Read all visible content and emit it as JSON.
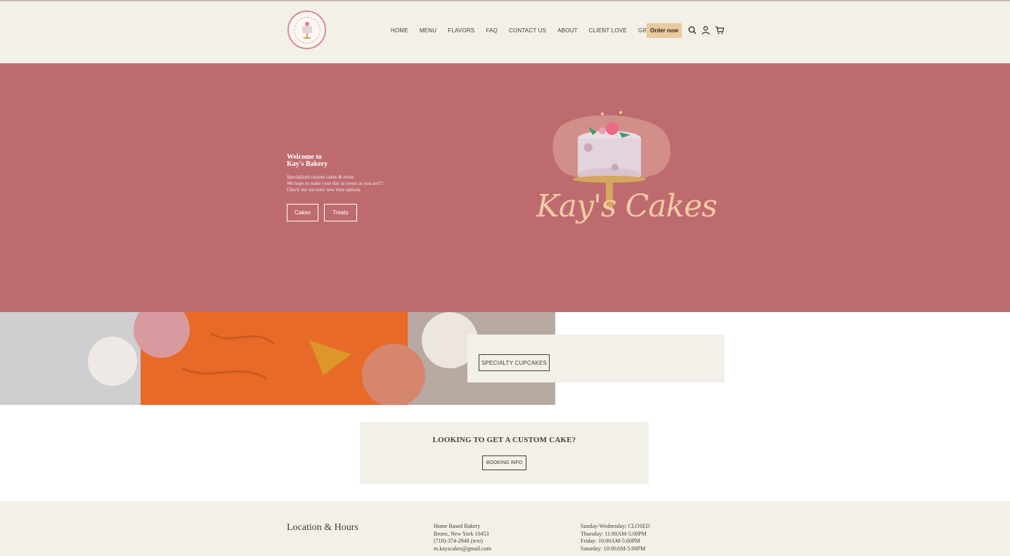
{
  "header": {
    "logo_alt": "Kay's Cakes logo",
    "nav": [
      "HOME",
      "MENU",
      "FLAVORS",
      "FAQ",
      "CONTACT US",
      "ABOUT",
      "CLIENT LOVE",
      "GIFT CARD"
    ],
    "order_button": "Order now",
    "icons": [
      "search-icon",
      "account-icon",
      "cart-icon"
    ]
  },
  "hero": {
    "title_line1": "Welcome to",
    "title_line2": "Kay's Bakery",
    "desc": [
      "Specialized custom cakes & treats",
      "We hope to make your day as sweet as you are!!!",
      "Check out our tasty new treat options"
    ],
    "buttons": [
      "Cakes",
      "Treats"
    ],
    "brand_script": "Kay's Cakes"
  },
  "feature": {
    "button": "SPECIALTY CUPCAKES"
  },
  "custom": {
    "title": "LOOKING TO GET A CUSTOM CAKE?",
    "button": "BOOKING INFO"
  },
  "footer": {
    "title": "Location & Hours",
    "address": [
      "Home Based Bakery",
      "Bronx, New York 10453",
      "(718)-374-2948 (text)",
      "m.kayscakes@gmail.com"
    ],
    "hours": [
      "Sunday-Wednesday: CLOSED",
      "Thursday: 11:00AM-5:00PM",
      "Friday: 10:00AM-5:00PM",
      "Saturday: 10:00AM-5:00PM"
    ]
  },
  "colors": {
    "hero_bg": "#be6b6f",
    "cream": "#f3f0ea",
    "accent": "#e8c9a0",
    "text": "#4a3a2a"
  }
}
